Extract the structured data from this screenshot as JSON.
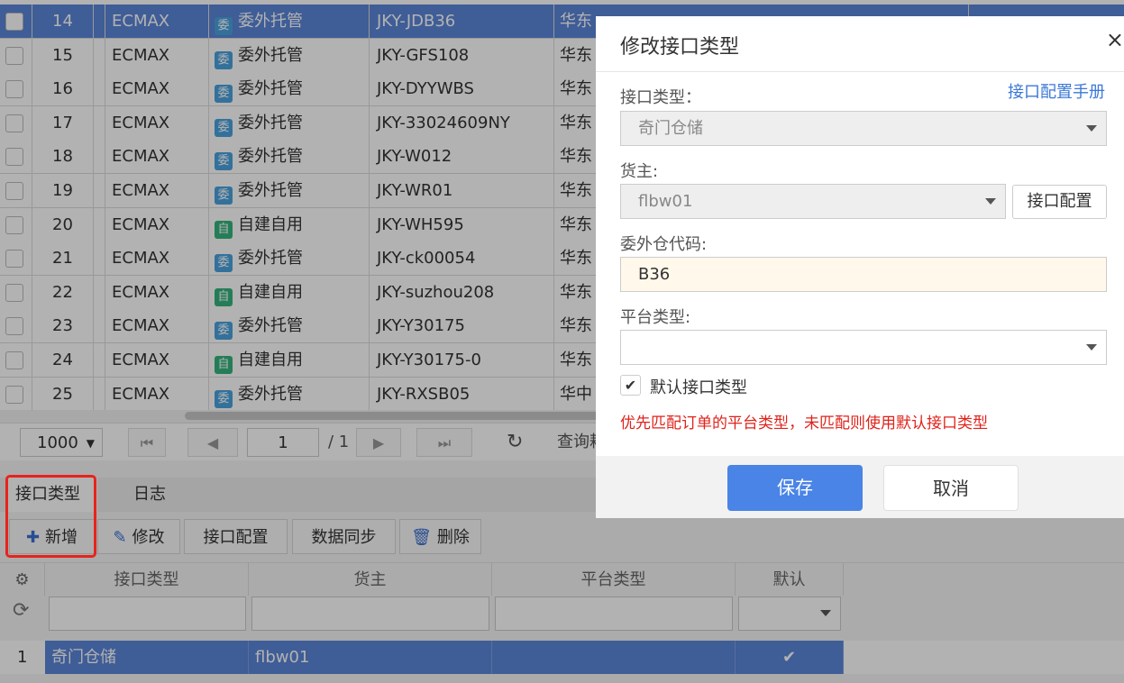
{
  "grid": {
    "rows": [
      {
        "num": "14",
        "org": "ECMAX",
        "type_badge": "委",
        "type": "委外托管",
        "code": "JKY-JDB36",
        "warehouse": "华东",
        "selected": true
      },
      {
        "num": "15",
        "org": "ECMAX",
        "type_badge": "委",
        "type": "委外托管",
        "code": "JKY-GFS108",
        "warehouse": "华东"
      },
      {
        "num": "16",
        "org": "ECMAX",
        "type_badge": "委",
        "type": "委外托管",
        "code": "JKY-DYYWBS",
        "warehouse": "华东"
      },
      {
        "num": "17",
        "org": "ECMAX",
        "type_badge": "委",
        "type": "委外托管",
        "code": "JKY-33024609NY",
        "warehouse": "华东"
      },
      {
        "num": "18",
        "org": "ECMAX",
        "type_badge": "委",
        "type": "委外托管",
        "code": "JKY-W012",
        "warehouse": "华东"
      },
      {
        "num": "19",
        "org": "ECMAX",
        "type_badge": "委",
        "type": "委外托管",
        "code": "JKY-WR01",
        "warehouse": "华东"
      },
      {
        "num": "20",
        "org": "ECMAX",
        "type_badge": "自",
        "type": "自建自用",
        "code": "JKY-WH595",
        "warehouse": "华东"
      },
      {
        "num": "21",
        "org": "ECMAX",
        "type_badge": "委",
        "type": "委外托管",
        "code": "JKY-ck00054",
        "warehouse": "华东"
      },
      {
        "num": "22",
        "org": "ECMAX",
        "type_badge": "自",
        "type": "自建自用",
        "code": "JKY-suzhou208",
        "warehouse": "华东"
      },
      {
        "num": "23",
        "org": "ECMAX",
        "type_badge": "委",
        "type": "委外托管",
        "code": "JKY-Y30175",
        "warehouse": "华东"
      },
      {
        "num": "24",
        "org": "ECMAX",
        "type_badge": "自",
        "type": "自建自用",
        "code": "JKY-Y30175-0",
        "warehouse": "华东"
      },
      {
        "num": "25",
        "org": "ECMAX",
        "type_badge": "委",
        "type": "委外托管",
        "code": "JKY-RXSB05",
        "warehouse": "华中"
      }
    ]
  },
  "pager": {
    "page_size": "1000",
    "current_page": "1",
    "total_pages": "/ 1",
    "query_label": "查询耗"
  },
  "bottom_tabs": {
    "interface_type": "接口类型",
    "log": "日志"
  },
  "toolbar": {
    "add": "新增",
    "edit": "修改",
    "config": "接口配置",
    "sync": "数据同步",
    "delete": "删除"
  },
  "subgrid": {
    "headers": {
      "interface_type": "接口类型",
      "owner": "货主",
      "platform_type": "平台类型",
      "default": "默认"
    },
    "row": {
      "num": "1",
      "interface_type": "奇门仓储",
      "owner": "flbw01",
      "platform_type": "",
      "default_checked": true
    }
  },
  "modal": {
    "title": "修改接口类型",
    "close": "×",
    "manual_link": "接口配置手册",
    "interface_type_label": "接口类型：",
    "interface_type_value": "奇门仓储",
    "owner_label": "货主:",
    "owner_value": "flbw01",
    "owner_config_button": "接口配置",
    "outsource_code_label": "委外仓代码:",
    "outsource_code_value": "B36",
    "platform_type_label": "平台类型:",
    "platform_type_value": "",
    "default_checkbox_label": "默认接口类型",
    "default_checked": true,
    "warning": "优先匹配订单的平台类型，未匹配则使用默认接口类型",
    "save": "保存",
    "cancel": "取消"
  },
  "colors": {
    "selected_row": "#5b86d8",
    "primary_button": "#4a84e6",
    "warning_text": "#e0231b",
    "highlight_box": "#e8231c"
  }
}
